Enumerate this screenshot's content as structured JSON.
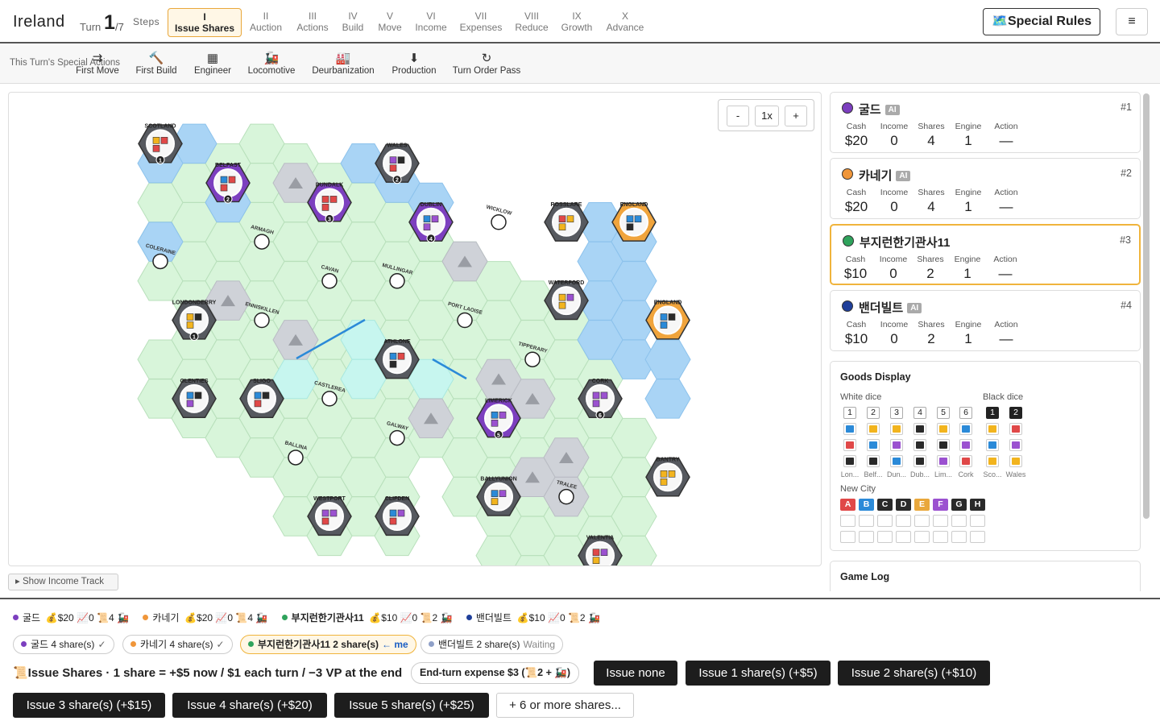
{
  "header": {
    "title": "Ireland",
    "turn_label": "Turn",
    "turn": "1",
    "turn_total": "/7",
    "steps_label": "Steps",
    "special_rules": "🗺️Special Rules",
    "menu": "≡"
  },
  "steps": [
    {
      "n": "I",
      "label": "Issue Shares"
    },
    {
      "n": "II",
      "label": "Auction"
    },
    {
      "n": "III",
      "label": "Actions"
    },
    {
      "n": "IV",
      "label": "Build"
    },
    {
      "n": "V",
      "label": "Move"
    },
    {
      "n": "VI",
      "label": "Income"
    },
    {
      "n": "VII",
      "label": "Expenses"
    },
    {
      "n": "VIII",
      "label": "Reduce"
    },
    {
      "n": "IX",
      "label": "Growth"
    },
    {
      "n": "X",
      "label": "Advance"
    }
  ],
  "actions": {
    "label": "This Turn's Special Actions",
    "items": [
      {
        "icon": "⇉",
        "label": "First Move"
      },
      {
        "icon": "🔨",
        "label": "First Build"
      },
      {
        "icon": "▦",
        "label": "Engineer"
      },
      {
        "icon": "🚂",
        "label": "Locomotive"
      },
      {
        "icon": "🏭",
        "label": "Deurbanization"
      },
      {
        "icon": "⬇",
        "label": "Production"
      },
      {
        "icon": "↻",
        "label": "Turn Order Pass"
      }
    ]
  },
  "zoom": {
    "minus": "-",
    "level": "1x",
    "plus": "+"
  },
  "income_track": "▸ Show Income Track",
  "colors": {
    "purple": "#7c3fbf",
    "orange": "#f0963a",
    "green": "#2fa35c",
    "navy": "#1f3f9a",
    "red": "#e04848",
    "blue": "#2b8ad8",
    "yellow": "#f2b41e",
    "violet": "#9b51d0",
    "black": "#2a2a2a",
    "land": "#d8f5da",
    "water": "#a9d4f5",
    "mountain": "#cfd2d8"
  },
  "map": {
    "cities": [
      {
        "name": "SCOTLAND",
        "num": "1"
      },
      {
        "name": "WALES",
        "num": "2"
      },
      {
        "name": "BELFAST",
        "num": "2"
      },
      {
        "name": "DUNDALK",
        "num": "3"
      },
      {
        "name": "DUBLIN",
        "num": "4"
      },
      {
        "name": "ROSSLARE",
        "num": ""
      },
      {
        "name": "ENGLAND",
        "num": ""
      },
      {
        "name": "WATERFORD",
        "num": ""
      },
      {
        "name": "ENGLAND",
        "num": ""
      },
      {
        "name": "LONDONDERRY",
        "num": "1"
      },
      {
        "name": "ATHLONE",
        "num": ""
      },
      {
        "name": "GLENTIES",
        "num": ""
      },
      {
        "name": "SLIGO",
        "num": ""
      },
      {
        "name": "CORK",
        "num": "6"
      },
      {
        "name": "LIMERICK",
        "num": "5"
      },
      {
        "name": "BANTRY",
        "num": ""
      },
      {
        "name": "BALLYUNION",
        "num": ""
      },
      {
        "name": "WESTPORT",
        "num": ""
      },
      {
        "name": "CLIFDEN",
        "num": ""
      },
      {
        "name": "VALENTIA",
        "num": ""
      }
    ],
    "towns": [
      {
        "name": "WICKLOW"
      },
      {
        "name": "ARMAGH"
      },
      {
        "name": "COLERAINE"
      },
      {
        "name": "CAVAN"
      },
      {
        "name": "MULLINGAR"
      },
      {
        "name": "ENNISKILLEN"
      },
      {
        "name": "PORT LAOISE"
      },
      {
        "name": "TIPPERARY"
      },
      {
        "name": "CASTLEREA"
      },
      {
        "name": "GALWAY"
      },
      {
        "name": "BALLINA"
      },
      {
        "name": "TRALEE"
      }
    ]
  },
  "players": [
    {
      "name": "굴드",
      "ai": "AI",
      "rank": "#1",
      "color": "#7c3fbf",
      "cash": "$20",
      "income": "0",
      "shares": "4",
      "engine": "1",
      "action": "—"
    },
    {
      "name": "카네기",
      "ai": "AI",
      "rank": "#2",
      "color": "#f0963a",
      "cash": "$20",
      "income": "0",
      "shares": "4",
      "engine": "1",
      "action": "—"
    },
    {
      "name": "부지런한기관사11",
      "ai": "",
      "rank": "#3",
      "color": "#2fa35c",
      "cash": "$10",
      "income": "0",
      "shares": "2",
      "engine": "1",
      "action": "—"
    },
    {
      "name": "밴더빌트",
      "ai": "AI",
      "rank": "#4",
      "color": "#1f3f9a",
      "cash": "$10",
      "income": "0",
      "shares": "2",
      "engine": "1",
      "action": "—"
    }
  ],
  "stat_labels": {
    "cash": "Cash",
    "income": "Income",
    "shares": "Shares",
    "engine": "Engine",
    "action": "Action"
  },
  "goods": {
    "title": "Goods Display",
    "white_label": "White dice",
    "black_label": "Black dice",
    "white_nums": [
      "1",
      "2",
      "3",
      "4",
      "5",
      "6"
    ],
    "black_nums": [
      "1",
      "2"
    ],
    "white_grid": [
      [
        "blue",
        "yellow",
        "yellow",
        "black",
        "yellow",
        "blue"
      ],
      [
        "red",
        "blue",
        "violet",
        "black",
        "black",
        "violet"
      ],
      [
        "black",
        "black",
        "blue",
        "black",
        "violet",
        "red"
      ]
    ],
    "black_grid": [
      [
        "yellow",
        "red"
      ],
      [
        "blue",
        "violet"
      ],
      [
        "yellow",
        "yellow"
      ]
    ],
    "white_cities": [
      "Lon...",
      "Belf...",
      "Dun...",
      "Dub...",
      "Lim...",
      "Cork"
    ],
    "black_cities": [
      "Sco...",
      "Wales"
    ],
    "newcity_label": "New City",
    "newcity": [
      "A",
      "B",
      "C",
      "D",
      "E",
      "F",
      "G",
      "H"
    ]
  },
  "game_log": "Game Log",
  "summary": [
    {
      "name": "굴드",
      "cash": "💰$20",
      "income": "📈0",
      "shares": "📜4",
      "engine": "🚂"
    },
    {
      "name": "카네기",
      "cash": "💰$20",
      "income": "📈0",
      "shares": "📜4",
      "engine": "🚂"
    },
    {
      "name": "부지런한기관사11",
      "cash": "💰$10",
      "income": "📈0",
      "shares": "📜2",
      "engine": "🚂"
    },
    {
      "name": "밴더빌트",
      "cash": "💰$10",
      "income": "📈0",
      "shares": "📜2",
      "engine": "🚂"
    }
  ],
  "chips": [
    {
      "text": "굴드 4 share(s)",
      "tag": "✓"
    },
    {
      "text": "카네기 4 share(s)",
      "tag": "✓"
    },
    {
      "text": "부지런한기관사11 2 share(s)",
      "tag": "← me"
    },
    {
      "text": "밴더빌트 2 share(s)",
      "tag": "Waiting"
    }
  ],
  "issue": {
    "title": "📜Issue Shares · 1 share = +$5 now / $1 each turn / −3 VP at the end",
    "expense": "End-turn expense $3 (📜2 + 🚂)",
    "buttons": [
      "Issue none",
      "Issue 1 share(s) (+$5)",
      "Issue 2 share(s) (+$10)",
      "Issue 3 share(s) (+$15)",
      "Issue 4 share(s) (+$20)",
      "Issue 5 share(s) (+$25)",
      "+ 6 or more shares..."
    ]
  }
}
